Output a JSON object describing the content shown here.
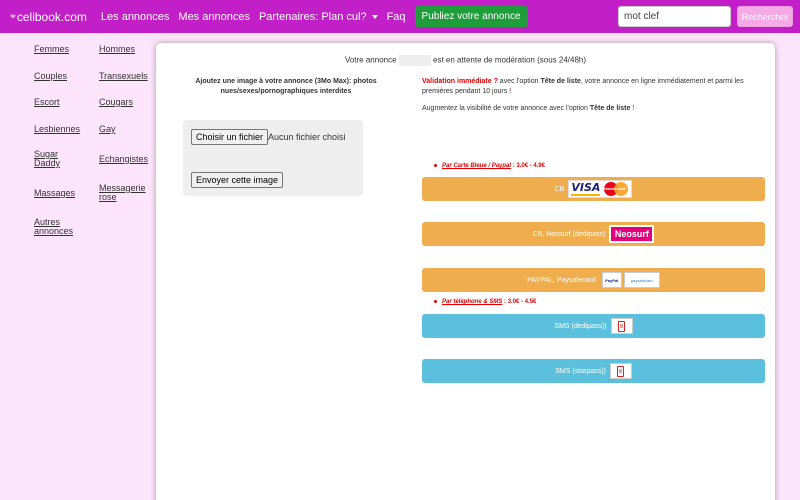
{
  "navbar": {
    "brand": "celibook.com",
    "links": [
      "Les annonces",
      "Mes annonces",
      "Partenaires: Plan cul?",
      "Faq"
    ],
    "publish_label": "Publiez votre annonce",
    "search_value": "mot clef",
    "search_button": "Rechercher"
  },
  "sidebar": {
    "left": [
      "Femmes",
      "Couples",
      "Escort",
      "Lesbiennes",
      "Sugar Daddy",
      "Massages",
      "Autres annonces"
    ],
    "right": [
      "Hommes",
      "Transexuels",
      "Cougars",
      "Gay",
      "Echangistes",
      "Messagerie rose"
    ]
  },
  "main": {
    "pending_prefix": "Votre annonce",
    "pending_suffix": "est en attente de modération (sous 24/48h)",
    "upload_title": "Ajoutez une image à votre annonce (3Mo Max): photos nues/sexes/pornographiques interdites",
    "file_button": "Choisir un fichier",
    "file_status": "Aucun fichier choisi",
    "send_button": "Envoyer cette image",
    "validation_red": "Validation immédiate ?",
    "validation_a": " avec l'option ",
    "validation_bold": "Tête de liste",
    "validation_b": ", votre annonce en ligne immédiatement et parmi les premières pendant 10 jours !",
    "visibility_a": "Augmentez la visibilité de votre annonce avec l'option ",
    "visibility_bold": "Tête de liste",
    "visibility_b": " !",
    "method_card": "Par Carte Bleue / Paypal",
    "method_card_price": " : 3.0€ - 4.9€",
    "method_sms": "Par téléphone & SMS",
    "method_sms_price": " : 3.0€ - 4.5€",
    "btn_cb": "CB",
    "btn_neosurf": "CB, Neosurf (dedipass)",
    "btn_paypal": "PAYPAL, Paysafecard",
    "btn_sms1": "SMS (dedipass))",
    "btn_sms2": "SMS (starpass))",
    "logo_visa": "VISA",
    "logo_mastercard": "MasterCard",
    "logo_neosurf": "Neosurf",
    "logo_paypal": "PayPal",
    "logo_paysafecard": "paysafecard"
  },
  "colors": {
    "navbar": "#c21fc8",
    "background": "#fce4fb",
    "publish": "#1e9d3a",
    "orange_button": "#f0ad4e",
    "blue_button": "#5bc0de",
    "alert_red": "#e00000"
  }
}
